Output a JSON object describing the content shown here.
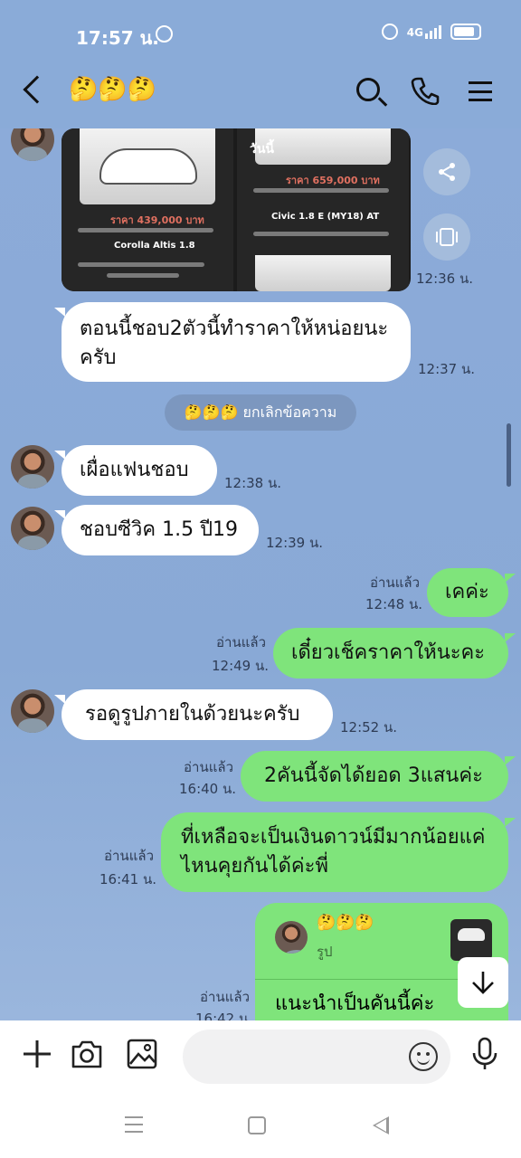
{
  "status": {
    "time": "17:57 น.",
    "network": "4G"
  },
  "header": {
    "title": "🤔🤔🤔"
  },
  "image_message": {
    "time": "12:36 น.",
    "overlay_text": "วันนี้",
    "cards": [
      {
        "price": "ราคา 439,000 บาท",
        "name": "Corolla Altis 1.8"
      },
      {
        "price": "ราคา 659,000 บาท",
        "name": "Civic 1.8 E (MY18) AT"
      }
    ]
  },
  "messages": [
    {
      "text": "ตอนนี้ชอบ2ตัวนี้ทำราคาให้หน่อยนะครับ",
      "time": "12:37 น."
    },
    {
      "text": "เผื่อแฟนชอบ",
      "time": "12:38 น."
    },
    {
      "text": "ชอบซีวิค 1.5 ปี19",
      "time": "12:39 น."
    },
    {
      "text": "เคค่ะ",
      "time": "12:48 น.",
      "read": "อ่านแล้ว"
    },
    {
      "text": "เดี๋ยวเช็คราคาให้นะคะ",
      "time": "12:49 น.",
      "read": "อ่านแล้ว"
    },
    {
      "text": "รอดูรูปภายในด้วยนะครับ",
      "time": "12:52 น."
    },
    {
      "text": "2คันนี้จัดได้ยอด 3แสนค่ะ",
      "time": "16:40 น.",
      "read": "อ่านแล้ว"
    },
    {
      "text": "ที่เหลือจะเป็นเงินดาวน์มีมากน้อยแค่ไหนคุยกันได้ค่ะพี่",
      "time": "16:41 น.",
      "read": "อ่านแล้ว"
    }
  ],
  "recall": {
    "text": "🤔🤔🤔 ยกเลิกข้อความ"
  },
  "reply_message": {
    "quoted_name": "🤔🤔🤔",
    "quoted_type": "รูป",
    "text": "แนะนำเป็นคันนี้ค่ะ",
    "time": "16:42 น.",
    "read": "อ่านแล้ว"
  },
  "input": {
    "placeholder": ""
  }
}
